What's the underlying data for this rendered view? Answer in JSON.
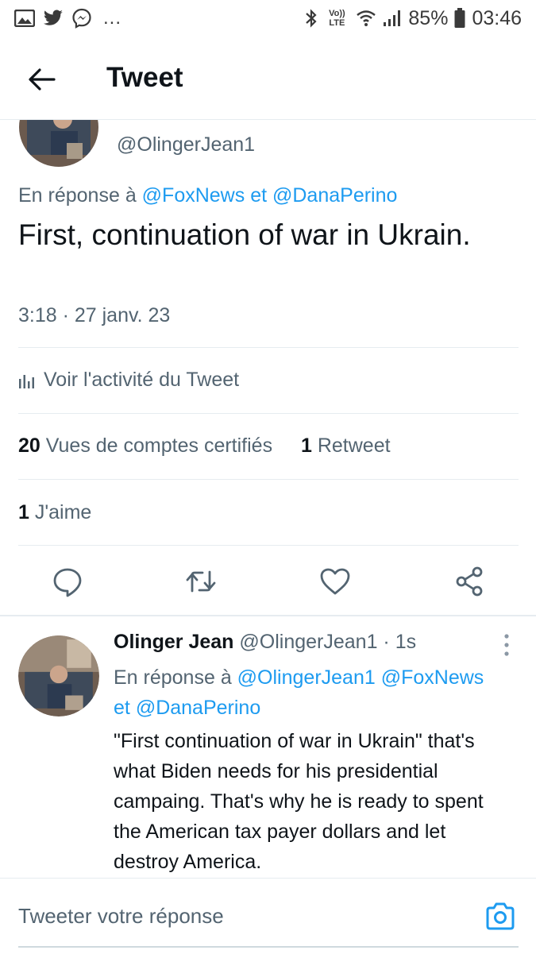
{
  "status_bar": {
    "battery": "85%",
    "time": "03:46",
    "more": "...",
    "volte": "Vo)) LTE",
    "icons": [
      "gallery-icon",
      "twitter-icon",
      "messenger-icon",
      "bluetooth-icon",
      "volte-icon",
      "wifi-icon",
      "signal-icon",
      "battery-icon"
    ]
  },
  "header": {
    "title": "Tweet"
  },
  "main_tweet": {
    "handle": "@OlingerJean1",
    "reply_prefix": "En réponse à ",
    "reply_to_1": "@FoxNews",
    "reply_conj": " et ",
    "reply_to_2": "@DanaPerino",
    "text": "First, continuation of war in Ukrain.",
    "timestamp": "3:18 · 27 janv. 23",
    "activity_label": "Voir l'activité du Tweet",
    "views_count": "20",
    "views_label": " Vues de comptes certifiés",
    "retweets_count": "1",
    "retweets_label": " Retweet",
    "likes_count": "1",
    "likes_label": " J'aime"
  },
  "reply_tweet": {
    "name": "Olinger Jean",
    "handle": " @OlingerJean1",
    "time": " · 1s",
    "reply_prefix": "En réponse à ",
    "reply_to_1": "@OlingerJean1",
    "reply_to_2": "@FoxNews",
    "reply_conj": "et",
    "reply_to_3": "@DanaPerino",
    "text": "\"First continuation of war in Ukrain\" that's what Biden needs for his presidential campaing. That's why he is ready to spent the American tax payer dollars and let destroy America."
  },
  "compose": {
    "placeholder": "Tweeter votre réponse"
  },
  "colors": {
    "accent": "#1d9bf0",
    "text": "#0f1419",
    "secondary": "#536471",
    "divider": "#e6ecf0"
  }
}
